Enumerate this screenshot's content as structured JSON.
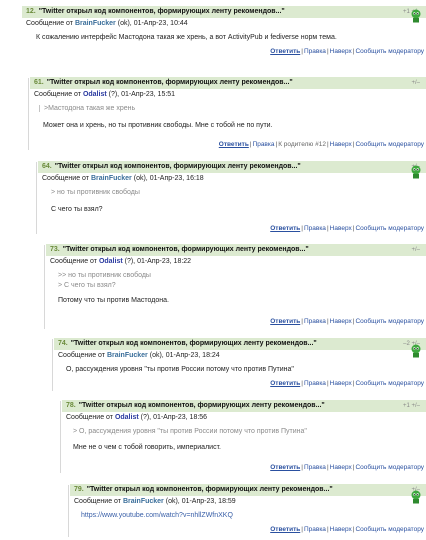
{
  "comments": [
    {
      "num": "12.",
      "title": "\"Twitter открыл код компонентов, формирующих ленту рекомендов...\"",
      "score": "+1 +/–",
      "meta_prefix": "Сообщение от",
      "user": "BrainFucker",
      "meta_suffix": "(ok), 01-Апр-23, 10:44",
      "text": [
        "К сожалению интерфейс Мастодона такая же хрень, а вот ActivityPub и fediverse норм тема."
      ],
      "links": {
        "reply": "Ответить",
        "edit": "Правка",
        "up": "Наверх",
        "report": "Сообщить модератору"
      }
    },
    {
      "num": "61.",
      "title": "\"Twitter открыл код компонентов, формирующих ленту рекомендов...\"",
      "score": "+/–",
      "meta_prefix": "Сообщение от",
      "user": "Odalist",
      "meta_suffix": "(?), 01-Апр-23, 15:51",
      "quotes": [
        ">Мастодона такая же хрень"
      ],
      "text": [
        "Может она и хрень, но ты противник свободы. Мне с тобой не по пути."
      ],
      "links": {
        "reply": "Ответить",
        "edit": "Правка",
        "parent": "К родителю #12",
        "up": "Наверх",
        "report": "Сообщить модератору"
      }
    },
    {
      "num": "64.",
      "title": "\"Twitter открыл код компонентов, формирующих ленту рекомендов...\"",
      "score": "+/–",
      "meta_prefix": "Сообщение от",
      "user": "BrainFucker",
      "meta_suffix": "(ok), 01-Апр-23, 16:18",
      "quotes": [
        "> но ты противник свободы"
      ],
      "text": [
        "С чего ты взял?"
      ],
      "links": {
        "reply": "Ответить",
        "edit": "Правка",
        "up": "Наверх",
        "report": "Сообщить модератору"
      }
    },
    {
      "num": "73.",
      "title": "\"Twitter открыл код компонентов, формирующих ленту рекомендов...\"",
      "score": "+/–",
      "meta_prefix": "Сообщение от",
      "user": "Odalist",
      "meta_suffix": "(?), 01-Апр-23, 18:22",
      "quotes": [
        ">> но ты противник свободы",
        "> С чего ты взял?"
      ],
      "text": [
        "Потому что ты против Мастодона."
      ],
      "links": {
        "reply": "Ответить",
        "edit": "Правка",
        "up": "Наверх",
        "report": "Сообщить модератору"
      }
    },
    {
      "num": "74.",
      "title": "\"Twitter открыл код компонентов, формирующих ленту рекомендов...\"",
      "score": "–2 +/–",
      "meta_prefix": "Сообщение от",
      "user": "BrainFucker",
      "meta_suffix": "(ok), 01-Апр-23, 18:24",
      "text": [
        "О, рассуждения уровня \"ты против России потому что против Путина\""
      ],
      "links": {
        "reply": "Ответить",
        "edit": "Правка",
        "up": "Наверх",
        "report": "Сообщить модератору"
      }
    },
    {
      "num": "78.",
      "title": "\"Twitter открыл код компонентов, формирующих ленту рекомендов...\"",
      "score": "+1 +/–",
      "meta_prefix": "Сообщение от",
      "user": "Odalist",
      "meta_suffix": "(?), 01-Апр-23, 18:56",
      "quotes": [
        "> О, рассуждения уровня \"ты против России потому что против Путина\""
      ],
      "text": [
        "Мне не о чем с тобой говорить, империалист."
      ],
      "links": {
        "reply": "Ответить",
        "edit": "Правка",
        "up": "Наверх",
        "report": "Сообщить модератору"
      }
    },
    {
      "num": "79.",
      "title": "\"Twitter открыл код компонентов, формирующих ленту рекомендов...\"",
      "score": "+/–",
      "meta_prefix": "Сообщение от",
      "user": "BrainFucker",
      "meta_suffix": "(ok), 01-Апр-23, 18:59",
      "url": "https://www.youtube.com/watch?v=nhllZWfnXKQ",
      "links": {
        "reply": "Ответить",
        "edit": "Правка",
        "up": "Наверх",
        "report": "Сообщить модератору"
      }
    }
  ],
  "colors": {
    "header_bg": "#dcead0",
    "link": "#2a50a0",
    "number": "#6a8a3a"
  },
  "icons": {
    "avatar": "green-alien-avatar-icon"
  }
}
